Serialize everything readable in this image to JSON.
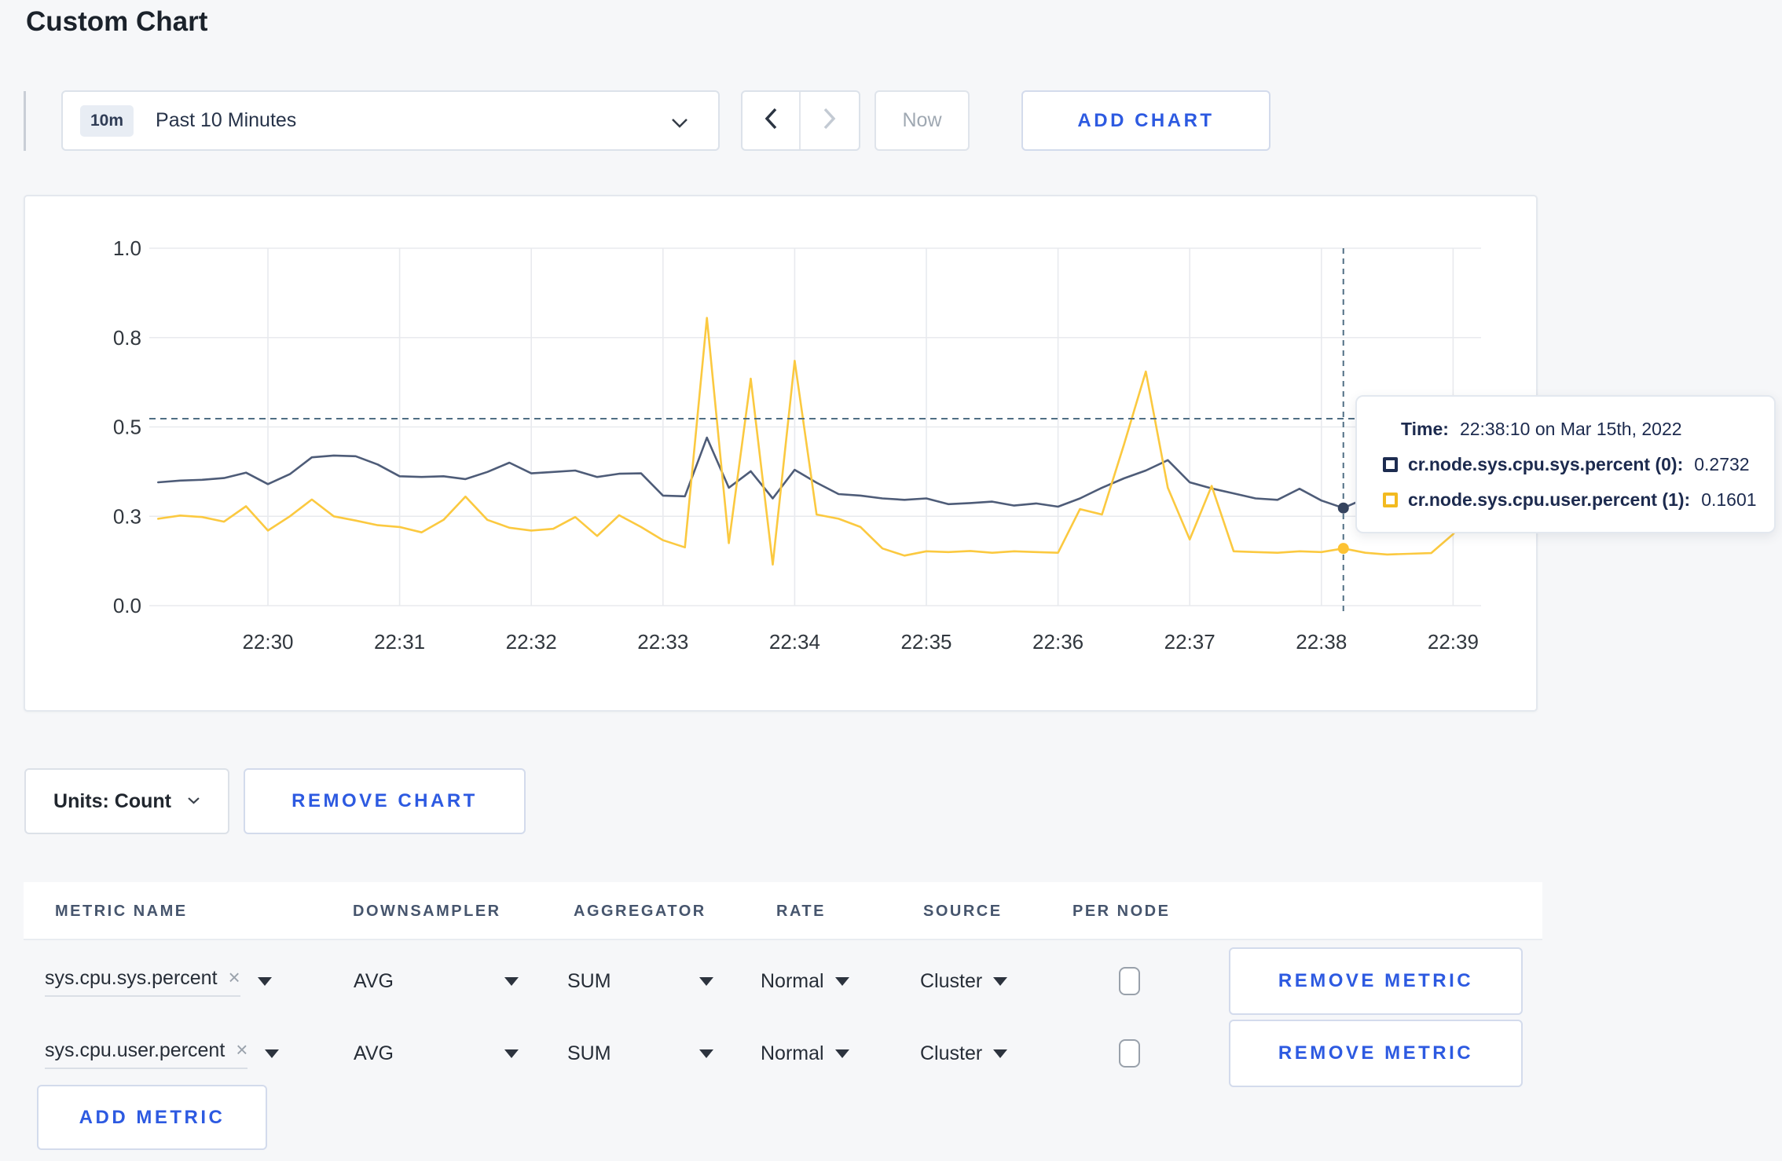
{
  "page": {
    "title": "Custom Chart"
  },
  "toolbar": {
    "time_badge": "10m",
    "time_label": "Past 10 Minutes",
    "now_label": "Now",
    "add_chart_label": "ADD CHART"
  },
  "controls": {
    "units_label": "Units: Count",
    "remove_chart_label": "REMOVE CHART",
    "add_metric_label": "ADD METRIC"
  },
  "icons": {
    "clear_icon": "×"
  },
  "colors": {
    "accent_blue": "#2d5ae1"
  },
  "metrics_table": {
    "headers": [
      "METRIC NAME",
      "DOWNSAMPLER",
      "AGGREGATOR",
      "RATE",
      "SOURCE",
      "PER NODE"
    ],
    "rows": [
      {
        "metric_name": "sys.cpu.sys.percent",
        "downsampler": "AVG",
        "aggregator": "SUM",
        "rate": "Normal",
        "source": "Cluster",
        "per_node_checked": false,
        "remove_label": "REMOVE METRIC"
      },
      {
        "metric_name": "sys.cpu.user.percent",
        "downsampler": "AVG",
        "aggregator": "SUM",
        "rate": "Normal",
        "source": "Cluster",
        "per_node_checked": false,
        "remove_label": "REMOVE METRIC"
      }
    ]
  },
  "chart_data": {
    "type": "line",
    "title": "",
    "xlabel": "",
    "ylabel": "",
    "ylim": [
      0,
      1
    ],
    "grid": true,
    "legend": "none",
    "x_unit": "seconds after 22:29:00 on Mar 15th, 2022",
    "grid_color": "#e8eaee",
    "tick_color": "#31373e",
    "crosshair_color": "#4f6e84",
    "y_ticks": [
      {
        "v": 0,
        "label": "0.0"
      },
      {
        "v": 0.25,
        "label": "0.3"
      },
      {
        "v": 0.5,
        "label": "0.5"
      },
      {
        "v": 0.75,
        "label": "0.8"
      },
      {
        "v": 1,
        "label": "1.0"
      }
    ],
    "x_ticks": [
      {
        "sec": 60,
        "label": "22:30"
      },
      {
        "sec": 120,
        "label": "22:31"
      },
      {
        "sec": 180,
        "label": "22:32"
      },
      {
        "sec": 240,
        "label": "22:33"
      },
      {
        "sec": 300,
        "label": "22:34"
      },
      {
        "sec": 360,
        "label": "22:35"
      },
      {
        "sec": 420,
        "label": "22:36"
      },
      {
        "sec": 480,
        "label": "22:37"
      },
      {
        "sec": 540,
        "label": "22:38"
      },
      {
        "sec": 600,
        "label": "22:39"
      }
    ],
    "series": [
      {
        "name": "cr.node.sys.cpu.sys.percent (0)",
        "color": "#4e5c78",
        "dot_color": "#36445f",
        "swatch": "#1d2c50",
        "points": [
          [
            10,
            0.345
          ],
          [
            20,
            0.35
          ],
          [
            30,
            0.352
          ],
          [
            40,
            0.357
          ],
          [
            50,
            0.372
          ],
          [
            60,
            0.34
          ],
          [
            70,
            0.368
          ],
          [
            80,
            0.415
          ],
          [
            90,
            0.42
          ],
          [
            100,
            0.418
          ],
          [
            110,
            0.395
          ],
          [
            120,
            0.362
          ],
          [
            130,
            0.36
          ],
          [
            140,
            0.362
          ],
          [
            150,
            0.354
          ],
          [
            160,
            0.374
          ],
          [
            170,
            0.4
          ],
          [
            180,
            0.37
          ],
          [
            190,
            0.374
          ],
          [
            200,
            0.378
          ],
          [
            210,
            0.36
          ],
          [
            220,
            0.369
          ],
          [
            230,
            0.37
          ],
          [
            240,
            0.308
          ],
          [
            250,
            0.306
          ],
          [
            260,
            0.47
          ],
          [
            270,
            0.33
          ],
          [
            280,
            0.376
          ],
          [
            290,
            0.3
          ],
          [
            300,
            0.38
          ],
          [
            310,
            0.344
          ],
          [
            320,
            0.312
          ],
          [
            330,
            0.308
          ],
          [
            340,
            0.3
          ],
          [
            350,
            0.296
          ],
          [
            360,
            0.3
          ],
          [
            370,
            0.284
          ],
          [
            380,
            0.287
          ],
          [
            390,
            0.291
          ],
          [
            400,
            0.28
          ],
          [
            410,
            0.286
          ],
          [
            420,
            0.277
          ],
          [
            430,
            0.3
          ],
          [
            440,
            0.33
          ],
          [
            450,
            0.356
          ],
          [
            460,
            0.378
          ],
          [
            470,
            0.407
          ],
          [
            480,
            0.345
          ],
          [
            490,
            0.328
          ],
          [
            500,
            0.314
          ],
          [
            510,
            0.3
          ],
          [
            520,
            0.296
          ],
          [
            530,
            0.327
          ],
          [
            540,
            0.294
          ],
          [
            550,
            0.2732
          ],
          [
            560,
            0.3
          ],
          [
            570,
            0.292
          ],
          [
            580,
            0.296
          ],
          [
            590,
            0.301
          ],
          [
            600,
            0.296
          ],
          [
            610,
            0.305
          ]
        ]
      },
      {
        "name": "cr.node.sys.cpu.user.percent (1)",
        "color": "#fbc940",
        "dot_color": "#fdc233",
        "swatch": "#f2ba20",
        "points": [
          [
            10,
            0.243
          ],
          [
            20,
            0.252
          ],
          [
            30,
            0.248
          ],
          [
            40,
            0.235
          ],
          [
            50,
            0.278
          ],
          [
            60,
            0.21
          ],
          [
            70,
            0.25
          ],
          [
            80,
            0.297
          ],
          [
            90,
            0.25
          ],
          [
            100,
            0.238
          ],
          [
            110,
            0.225
          ],
          [
            120,
            0.22
          ],
          [
            130,
            0.205
          ],
          [
            140,
            0.24
          ],
          [
            150,
            0.305
          ],
          [
            160,
            0.24
          ],
          [
            170,
            0.218
          ],
          [
            180,
            0.21
          ],
          [
            190,
            0.215
          ],
          [
            200,
            0.248
          ],
          [
            210,
            0.195
          ],
          [
            220,
            0.253
          ],
          [
            230,
            0.22
          ],
          [
            240,
            0.183
          ],
          [
            250,
            0.163
          ],
          [
            260,
            0.805
          ],
          [
            270,
            0.175
          ],
          [
            280,
            0.635
          ],
          [
            290,
            0.115
          ],
          [
            300,
            0.685
          ],
          [
            310,
            0.255
          ],
          [
            320,
            0.243
          ],
          [
            330,
            0.22
          ],
          [
            340,
            0.16
          ],
          [
            350,
            0.14
          ],
          [
            360,
            0.152
          ],
          [
            370,
            0.15
          ],
          [
            380,
            0.153
          ],
          [
            390,
            0.148
          ],
          [
            400,
            0.152
          ],
          [
            410,
            0.15
          ],
          [
            420,
            0.148
          ],
          [
            430,
            0.27
          ],
          [
            440,
            0.255
          ],
          [
            450,
            0.45
          ],
          [
            460,
            0.655
          ],
          [
            470,
            0.33
          ],
          [
            480,
            0.185
          ],
          [
            490,
            0.335
          ],
          [
            500,
            0.152
          ],
          [
            510,
            0.15
          ],
          [
            520,
            0.148
          ],
          [
            530,
            0.152
          ],
          [
            540,
            0.15
          ],
          [
            550,
            0.1601
          ],
          [
            560,
            0.148
          ],
          [
            570,
            0.143
          ],
          [
            580,
            0.145
          ],
          [
            590,
            0.147
          ],
          [
            600,
            0.2
          ],
          [
            610,
            0.28
          ]
        ]
      }
    ],
    "crosshair": {
      "sec": 550,
      "value": 0.523
    },
    "tooltip": {
      "time_label": "Time:",
      "time_value": "22:38:10 on Mar 15th, 2022",
      "rows": [
        {
          "label": "cr.node.sys.cpu.sys.percent (0):",
          "value": "0.2732"
        },
        {
          "label": "cr.node.sys.cpu.user.percent (1):",
          "value": "0.1601"
        }
      ]
    }
  }
}
